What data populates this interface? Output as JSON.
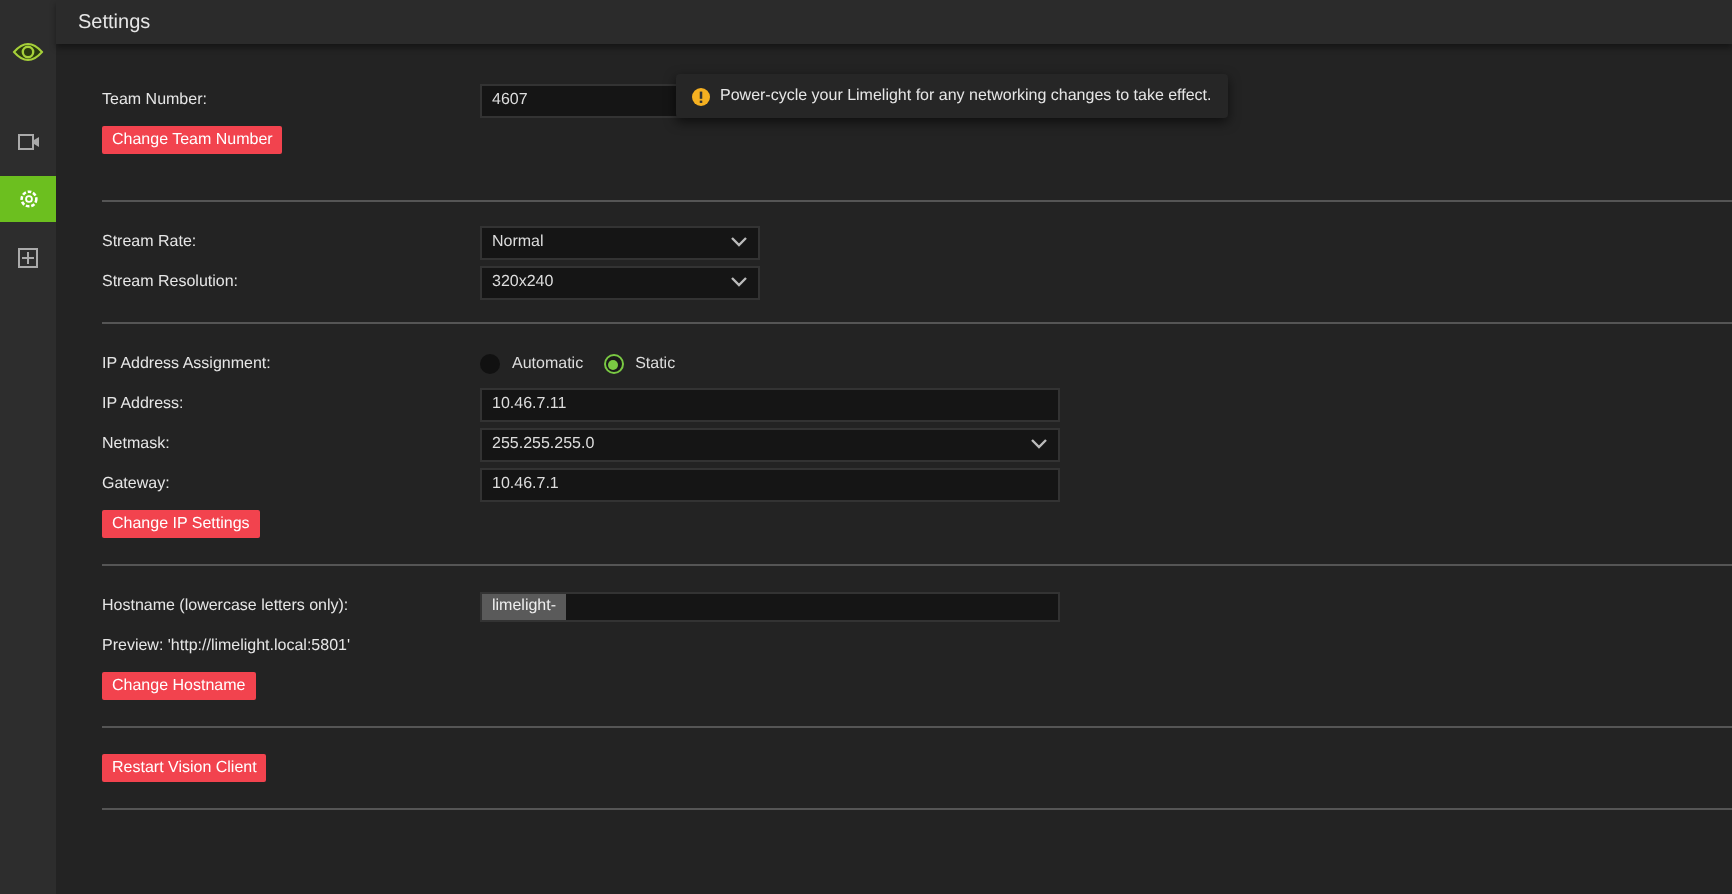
{
  "header": {
    "title": "Settings"
  },
  "sidebar": {
    "items": [
      {
        "selected": false
      },
      {
        "selected": true
      },
      {
        "selected": false
      }
    ]
  },
  "toast": {
    "message": "Power-cycle your Limelight for any networking changes to take effect."
  },
  "sections": [
    {
      "rows": [
        {
          "kind": "input",
          "label": "Team Number:",
          "value": "4607"
        },
        {
          "kind": "button",
          "label": "Change Team Number"
        }
      ]
    },
    {
      "rows": [
        {
          "kind": "select",
          "label": "Stream Rate:",
          "value": "Normal"
        },
        {
          "kind": "select",
          "label": "Stream Resolution:",
          "value": "320x240"
        }
      ]
    },
    {
      "rows": [
        {
          "kind": "radio",
          "label": "IP Address Assignment:",
          "options": [
            {
              "label": "Automatic",
              "selected": false
            },
            {
              "label": "Static",
              "selected": true
            }
          ]
        },
        {
          "kind": "input",
          "label": "IP Address:",
          "value": "10.46.7.11"
        },
        {
          "kind": "select",
          "label": "Netmask:",
          "value": "255.255.255.0"
        },
        {
          "kind": "input",
          "label": "Gateway:",
          "value": "10.46.7.1"
        },
        {
          "kind": "button",
          "label": "Change IP Settings"
        }
      ]
    },
    {
      "rows": [
        {
          "kind": "prefix",
          "label": "Hostname (lowercase letters only):",
          "prefix": "limelight-"
        },
        {
          "kind": "text",
          "label": "Preview: 'http://limelight.local:5801'"
        },
        {
          "kind": "button",
          "label": "Change Hostname"
        }
      ]
    },
    {
      "rows": [
        {
          "kind": "button",
          "label": "Restart Vision Client"
        }
      ]
    }
  ]
}
